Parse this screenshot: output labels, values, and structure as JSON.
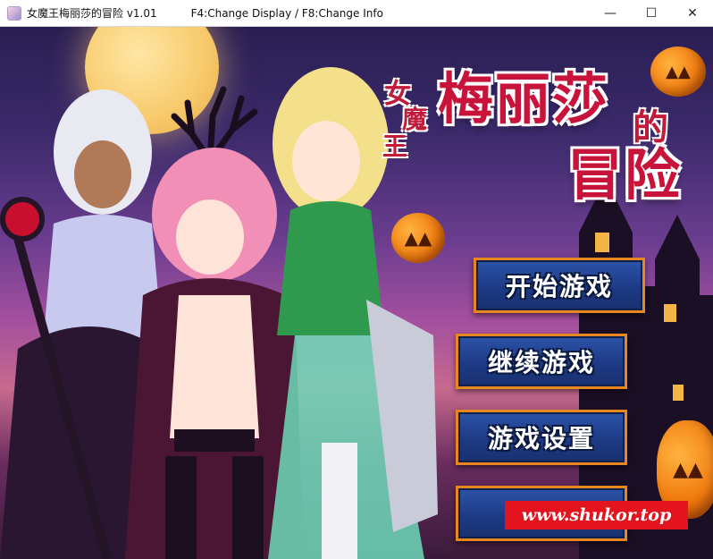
{
  "window": {
    "title": "女魔王梅丽莎的冒险 v1.01",
    "hint": "F4:Change Display / F8:Change Info",
    "minimize_glyph": "—",
    "maximize_glyph": "☐",
    "close_glyph": "✕"
  },
  "logo": {
    "line1_chars": [
      "女",
      "魔",
      "王"
    ],
    "main": "梅丽莎",
    "particle": "的",
    "sub": "冒险"
  },
  "menu": {
    "items": [
      {
        "label": "开始游戏"
      },
      {
        "label": "继续游戏"
      },
      {
        "label": "游戏设置"
      },
      {
        "label": ""
      }
    ]
  },
  "watermark": {
    "text": "www.shukor.top"
  },
  "colors": {
    "menu_border": "#e6871f",
    "menu_fill": "#1e3a86",
    "logo_red": "#c8143a",
    "watermark_bg": "#e3141e"
  },
  "icons": {
    "app": "game-app-icon",
    "pumpkin": "jack-o-lantern-icon"
  }
}
